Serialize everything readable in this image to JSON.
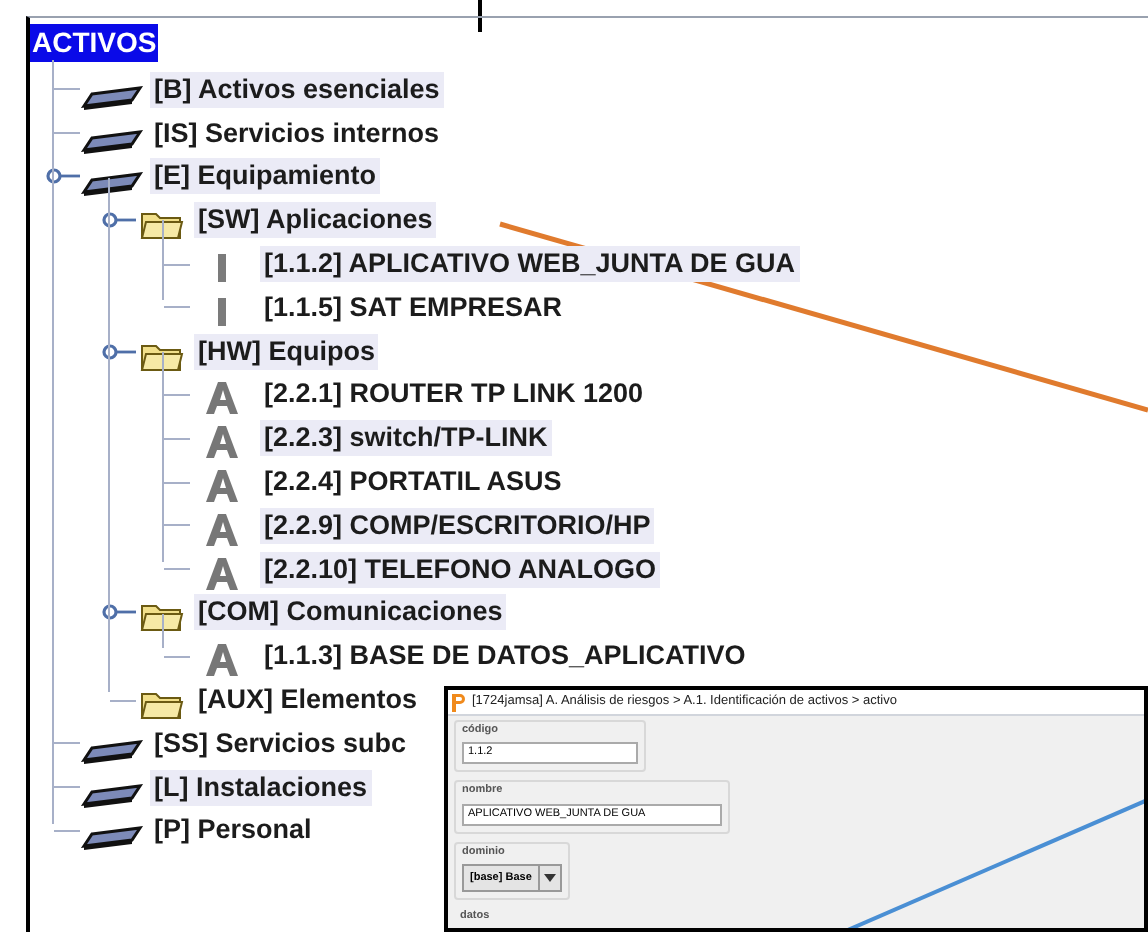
{
  "tree": {
    "root": {
      "label": "ACTIVOS",
      "selected": true
    },
    "nodes": [
      {
        "label": "[B] Activos esenciales",
        "kind": "layer",
        "highlighted": true,
        "expanded": false
      },
      {
        "label": "[IS] Servicios internos",
        "kind": "layer",
        "highlighted": false,
        "expanded": false
      },
      {
        "label": "[E] Equipamiento",
        "kind": "layer",
        "highlighted": true,
        "expanded": true,
        "children": [
          {
            "label": "[SW] Aplicaciones",
            "kind": "folder",
            "highlighted": true,
            "expanded": true,
            "children": [
              {
                "label": "[1.1.2] APLICATIVO WEB_JUNTA DE GUA",
                "kind": "application",
                "highlighted": true,
                "expanded": false
              },
              {
                "label": "[1.1.5] SAT EMPRESAR",
                "kind": "application",
                "highlighted": false,
                "expanded": false
              }
            ]
          },
          {
            "label": "[HW] Equipos",
            "kind": "folder",
            "highlighted": true,
            "expanded": true,
            "children": [
              {
                "label": "[2.2.1] ROUTER TP LINK 1200",
                "kind": "equipment",
                "highlighted": false,
                "expanded": false
              },
              {
                "label": "[2.2.3] switch/TP-LINK",
                "kind": "equipment",
                "highlighted": true,
                "expanded": false
              },
              {
                "label": "[2.2.4] PORTATIL ASUS",
                "kind": "equipment",
                "highlighted": false,
                "expanded": false
              },
              {
                "label": "[2.2.9] COMP/ESCRITORIO/HP",
                "kind": "equipment",
                "highlighted": true,
                "expanded": false
              },
              {
                "label": "[2.2.10] TELEFONO ANALOGO",
                "kind": "equipment",
                "highlighted": true,
                "expanded": false
              }
            ]
          },
          {
            "label": "[COM] Comunicaciones",
            "kind": "folder",
            "highlighted": true,
            "expanded": true,
            "children": [
              {
                "label": "[1.1.3] BASE DE DATOS_APLICATIVO",
                "kind": "equipment",
                "highlighted": false,
                "expanded": false
              }
            ]
          },
          {
            "label": "[AUX] Elementos",
            "kind": "folder",
            "highlighted": false,
            "expanded": false
          }
        ]
      },
      {
        "label": "[SS] Servicios subc",
        "kind": "layer",
        "highlighted": false,
        "expanded": false
      },
      {
        "label": "[L] Instalaciones",
        "kind": "layer",
        "highlighted": true,
        "expanded": false
      },
      {
        "label": "[P] Personal",
        "kind": "layer",
        "highlighted": false,
        "expanded": false
      }
    ]
  },
  "detail_window": {
    "title": "[1724jamsa] A. Análisis de riesgos > A.1. Identificación de activos > activo",
    "fields": [
      {
        "label": "código",
        "kind": "text",
        "value": "1.1.2"
      },
      {
        "label": "nombre",
        "kind": "text",
        "value": "APLICATIVO WEB_JUNTA DE GUA"
      },
      {
        "label": "dominio",
        "kind": "dropdown",
        "value": "[base] Base"
      },
      {
        "label": "datos",
        "kind": "section"
      }
    ]
  }
}
